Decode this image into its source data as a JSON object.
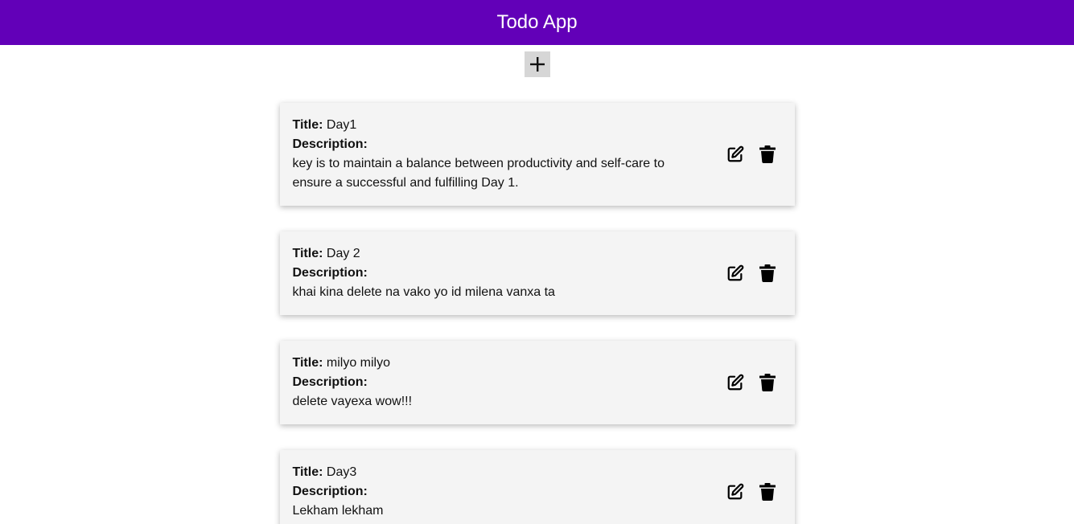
{
  "header": {
    "title": "Todo App",
    "background": "#6200b8"
  },
  "add_button": {
    "icon": "plus-icon"
  },
  "labels": {
    "title": "Title:",
    "description": "Description:"
  },
  "todos": [
    {
      "title": "Day1",
      "description": "key is to maintain a balance between productivity and self-care to ensure a successful and fulfilling Day 1."
    },
    {
      "title": "Day 2",
      "description": "khai kina delete na vako yo id milena vanxa ta"
    },
    {
      "title": "milyo milyo",
      "description": "delete vayexa wow!!!"
    },
    {
      "title": "Day3",
      "description": "Lekham lekham"
    }
  ],
  "icons": {
    "edit": "edit-icon",
    "delete": "trash-icon"
  }
}
